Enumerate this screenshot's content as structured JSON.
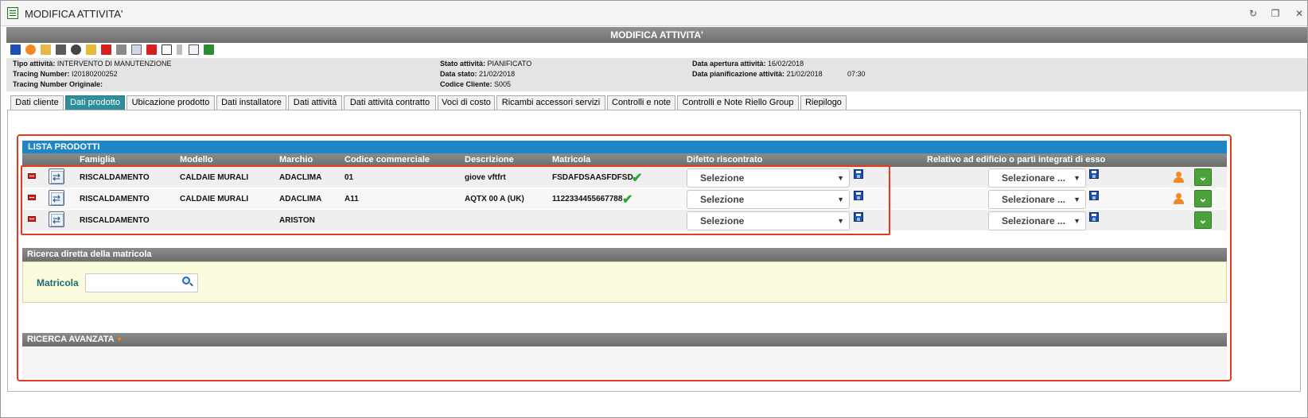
{
  "window": {
    "title": "MODIFICA ATTIVITA'",
    "band_title": "MODIFICA ATTIVITA'"
  },
  "info": {
    "tipo_label": "Tipo attività:",
    "tipo_value": "INTERVENTO DI MANUTENZIONE",
    "tracing_label": "Tracing Number:",
    "tracing_value": "I20180200252",
    "tracing_orig_label": "Tracing Number Originale:",
    "stato_label": "Stato attività:",
    "stato_value": "PIANIFICATO",
    "datastato_label": "Data stato:",
    "datastato_value": "21/02/2018",
    "cliente_label": "Codice Cliente:",
    "cliente_value": "S005",
    "apertura_label": "Data apertura attività:",
    "apertura_value": "16/02/2018",
    "pianif_label": "Data pianificazione attività:",
    "pianif_value": "21/02/2018",
    "pianif_time": "07:30"
  },
  "tabs": [
    "Dati cliente",
    "Dati prodotto",
    "Ubicazione prodotto",
    "Dati installatore",
    "Dati attività",
    "Dati attività contratto",
    "Voci di costo",
    "Ricambi accessori servizi",
    "Controlli e note",
    "Controlli e Note Riello Group",
    "Riepilogo"
  ],
  "lista": {
    "title": "LISTA PRODOTTI",
    "headers": [
      "Famiglia",
      "Modello",
      "Marchio",
      "Codice commerciale",
      "Descrizione",
      "Matricola",
      "Difetto riscontrato",
      "Relativo ad edificio o parti integrati di esso"
    ],
    "rows": [
      {
        "famiglia": "RISCALDAMENTO",
        "modello": "CALDAIE MURALI",
        "marchio": "ADACLIMA",
        "codice": "01",
        "descrizione": "giove vftfrt",
        "matricola": "FSDAFDSAASFDFSD",
        "difetto": "Selezione",
        "relativo": "Selezionare ..."
      },
      {
        "famiglia": "RISCALDAMENTO",
        "modello": "CALDAIE MURALI",
        "marchio": "ADACLIMA",
        "codice": "A11",
        "descrizione": "AQTX 00 A (UK)",
        "matricola": "1122334455667788",
        "difetto": "Selezione",
        "relativo": "Selezionare ..."
      },
      {
        "famiglia": "RISCALDAMENTO",
        "modello": "",
        "marchio": "ARISTON",
        "codice": "",
        "descrizione": "",
        "matricola": "",
        "difetto": "Selezione",
        "relativo": "Selezionare ..."
      }
    ]
  },
  "ricerca_diretta": {
    "title": "Ricerca diretta della matricola",
    "label": "Matricola",
    "value": ""
  },
  "ricerca_avanzata": {
    "title": "RICERCA AVANZATA"
  },
  "icons": {
    "check": "✔",
    "down": "⌄",
    "swap": "⇄",
    "restore": "↻",
    "maximize": "❐",
    "close": "✕",
    "dropdown": "▼"
  },
  "colors": {
    "accent": "#1c86c9",
    "active_tab": "#2f8e99",
    "highlight": "#e33b1f",
    "ok": "#4aa23a"
  }
}
